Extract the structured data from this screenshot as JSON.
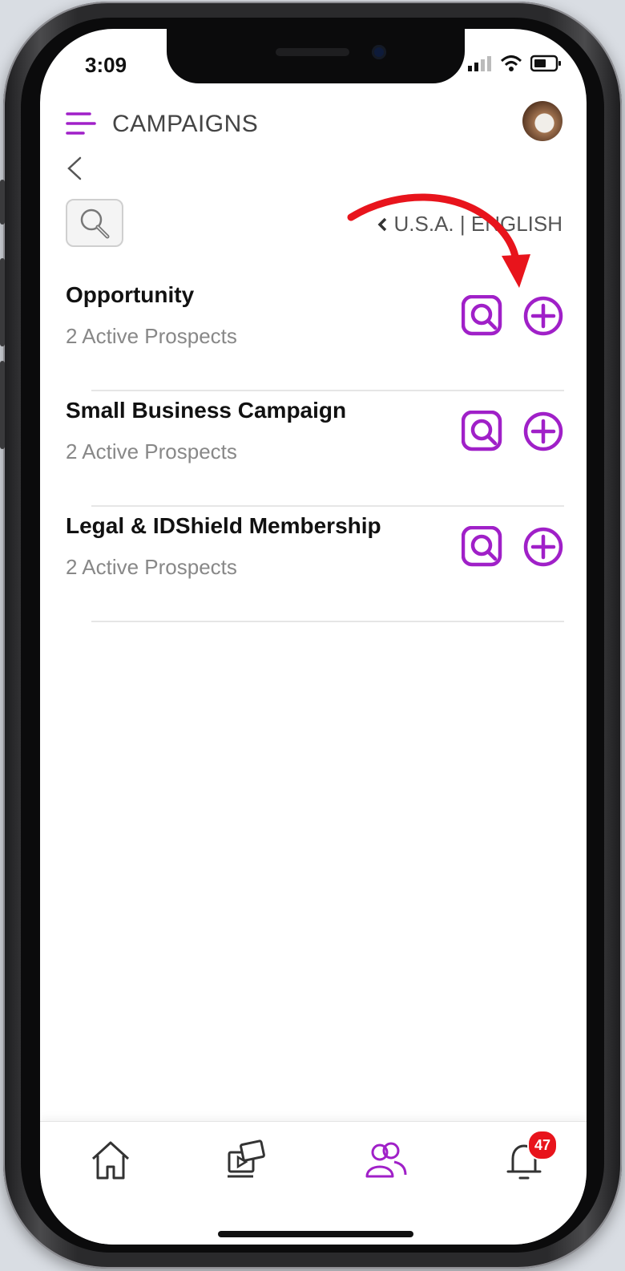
{
  "status_bar": {
    "time": "3:09"
  },
  "header": {
    "title": "CAMPAIGNS"
  },
  "locale": {
    "label": "U.S.A. | ENGLISH"
  },
  "campaigns": [
    {
      "title": "Opportunity",
      "subtitle": "2 Active Prospects"
    },
    {
      "title": "Small Business Campaign",
      "subtitle": "2 Active Prospects"
    },
    {
      "title": "Legal & IDShield Membership",
      "subtitle": "2 Active Prospects"
    }
  ],
  "tabbar": {
    "notifications_badge": "47",
    "active_tab": "contacts"
  },
  "colors": {
    "accent": "#a020c8",
    "annotation_arrow": "#e8141c",
    "badge": "#e8141c"
  },
  "icons": [
    "menu-icon",
    "back-chevron-icon",
    "search-icon",
    "prospect-search-icon",
    "add-circle-icon",
    "home-icon",
    "media-icon",
    "contacts-icon",
    "bell-icon"
  ]
}
